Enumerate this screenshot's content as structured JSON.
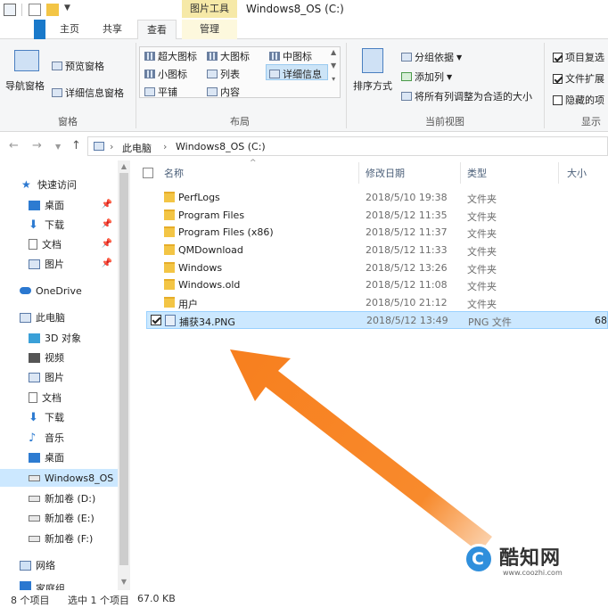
{
  "window": {
    "title": "Windows8_OS (C:)",
    "context_tab": "图片工具"
  },
  "tabs": [
    {
      "label": "主页"
    },
    {
      "label": "共享"
    },
    {
      "label": "查看"
    },
    {
      "label": "管理"
    }
  ],
  "ribbon": {
    "pane_group": {
      "label": "窗格",
      "nav_pane": "导航窗格",
      "preview_pane": "预览窗格",
      "details_pane": "详细信息窗格"
    },
    "layout_group": {
      "label": "布局",
      "items": [
        "超大图标",
        "大图标",
        "中图标",
        "小图标",
        "列表",
        "详细信息",
        "平铺",
        "内容"
      ],
      "selected": "详细信息"
    },
    "view_group": {
      "label": "当前视图",
      "sort_by": "排序方式",
      "group_by": "分组依据",
      "add_column": "添加列",
      "fit_columns": "将所有列调整为合适的大小"
    },
    "show_group": {
      "label": "显示",
      "checkboxes": [
        {
          "label": "项目复选",
          "checked": true
        },
        {
          "label": "文件扩展",
          "checked": true
        },
        {
          "label": "隐藏的项",
          "checked": false
        }
      ]
    }
  },
  "address": {
    "crumbs": [
      "此电脑",
      "Windows8_OS (C:)"
    ]
  },
  "nav_pane": {
    "quick_access": "快速访问",
    "quick_items": [
      "桌面",
      "下载",
      "文档",
      "图片"
    ],
    "onedrive": "OneDrive",
    "this_pc": "此电脑",
    "pc_items": [
      "3D 对象",
      "视频",
      "图片",
      "文档",
      "下载",
      "音乐",
      "桌面",
      "Windows8_OS",
      "新加卷 (D:)",
      "新加卷 (E:)",
      "新加卷 (F:)"
    ],
    "network": "网络",
    "cut_off": "家庭组"
  },
  "file_list": {
    "columns": [
      "名称",
      "修改日期",
      "类型",
      "大小"
    ],
    "rows": [
      {
        "name": "PerfLogs",
        "date": "2018/5/10 19:38",
        "type": "文件夹",
        "size": ""
      },
      {
        "name": "Program Files",
        "date": "2018/5/12 11:35",
        "type": "文件夹",
        "size": ""
      },
      {
        "name": "Program Files (x86)",
        "date": "2018/5/12 11:37",
        "type": "文件夹",
        "size": ""
      },
      {
        "name": "QMDownload",
        "date": "2018/5/12 11:33",
        "type": "文件夹",
        "size": ""
      },
      {
        "name": "Windows",
        "date": "2018/5/12 13:26",
        "type": "文件夹",
        "size": ""
      },
      {
        "name": "Windows.old",
        "date": "2018/5/12 11:08",
        "type": "文件夹",
        "size": ""
      },
      {
        "name": "用户",
        "date": "2018/5/10 21:12",
        "type": "文件夹",
        "size": ""
      },
      {
        "name": "捕获34.PNG",
        "date": "2018/5/12 13:49",
        "type": "PNG 文件",
        "size": "68"
      }
    ]
  },
  "status": {
    "count": "8 个项目",
    "selected": "选中 1 个项目",
    "size": "67.0 KB"
  },
  "watermark": {
    "logo_letter": "C",
    "text": "酷知网",
    "url": "www.coozhi.com"
  },
  "colors": {
    "accent_blue": "#1979ca",
    "selection": "#cce8ff",
    "arrow_orange": "#f77f1e",
    "folder": "#f3c545"
  }
}
